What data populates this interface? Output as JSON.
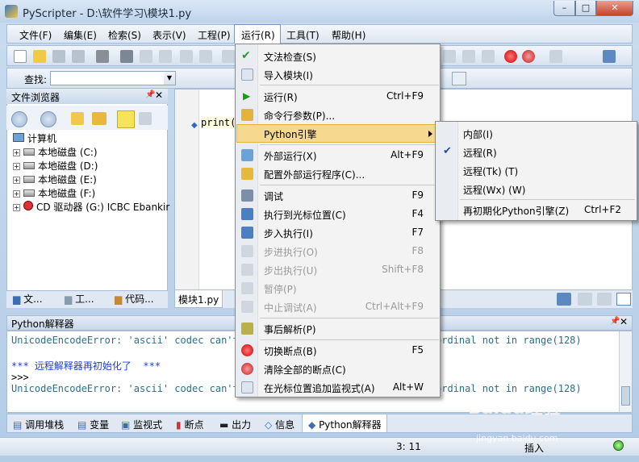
{
  "window": {
    "title": "PyScripter - D:\\软件学习\\模块1.py",
    "min": "–",
    "max": "□",
    "close": "✕"
  },
  "menubar": [
    "文件(F)",
    "编集(E)",
    "检索(S)",
    "表示(V)",
    "工程(P)",
    "运行(R)",
    "工具(T)",
    "帮助(H)"
  ],
  "toolbar": {
    "find_label": "查找:",
    "find_value": ""
  },
  "file_browser": {
    "title": "文件浏览器",
    "root": "计算机",
    "drives": [
      "本地磁盘 (C:)",
      "本地磁盘 (D:)",
      "本地磁盘 (E:)",
      "本地磁盘 (F:)",
      "CD 驱动器 (G:) ICBC Ebankir"
    ],
    "tabs": [
      "文...",
      "工...",
      "代码..."
    ]
  },
  "editor": {
    "code": "print(",
    "tab": "模块1.py"
  },
  "run_menu": [
    {
      "label": "文法检查(S)",
      "shortcut": ""
    },
    {
      "label": "导入模块(I)",
      "shortcut": ""
    },
    {
      "label": "运行(R)",
      "shortcut": "Ctrl+F9"
    },
    {
      "label": "命令行参数(P)...",
      "shortcut": ""
    },
    {
      "label": "Python引擎",
      "shortcut": ""
    },
    {
      "label": "外部运行(X)",
      "shortcut": "Alt+F9"
    },
    {
      "label": "配置外部运行程序(C)...",
      "shortcut": ""
    },
    {
      "label": "调试",
      "shortcut": "F9"
    },
    {
      "label": "执行到光标位置(C)",
      "shortcut": "F4"
    },
    {
      "label": "步入执行(I)",
      "shortcut": "F7"
    },
    {
      "label": "步进执行(O)",
      "shortcut": "F8"
    },
    {
      "label": "步出执行(U)",
      "shortcut": "Shift+F8"
    },
    {
      "label": "暂停(P)",
      "shortcut": ""
    },
    {
      "label": "中止调试(A)",
      "shortcut": "Ctrl+Alt+F9"
    },
    {
      "label": "事后解析(P)",
      "shortcut": ""
    },
    {
      "label": "切换断点(B)",
      "shortcut": "F5"
    },
    {
      "label": "清除全部的断点(C)",
      "shortcut": ""
    },
    {
      "label": "在光标位置追加监视式(A)",
      "shortcut": "Alt+W"
    }
  ],
  "engine_submenu": [
    {
      "label": "内部(I)",
      "shortcut": ""
    },
    {
      "label": "远程(R)",
      "shortcut": "",
      "checked": true
    },
    {
      "label": "远程(Tk) (T)",
      "shortcut": ""
    },
    {
      "label": "远程(Wx) (W)",
      "shortcut": ""
    },
    {
      "label": "再初期化Python引擎(Z)",
      "shortcut": "Ctrl+F2"
    }
  ],
  "interpreter": {
    "title": "Python解释器",
    "line1_left": "UnicodeEncodeError: 'ascii' codec can't",
    "line1_right": "ordinal not in range(128)",
    "line2": "*** 远程解释器再初始化了  ***",
    "line3": ">>>",
    "line4_left": "UnicodeEncodeError: 'ascii' codec can't",
    "line4_right": "ordinal not in range(128)"
  },
  "bottom_tabs": [
    "调用堆栈",
    "变量",
    "监视式",
    "断点",
    "出力",
    "信息",
    "Python解释器"
  ],
  "status": {
    "position": "3: 11",
    "mode": "插入"
  },
  "watermark": {
    "brand": "Baidu经验",
    "url": "jingyan.baidu.com"
  }
}
